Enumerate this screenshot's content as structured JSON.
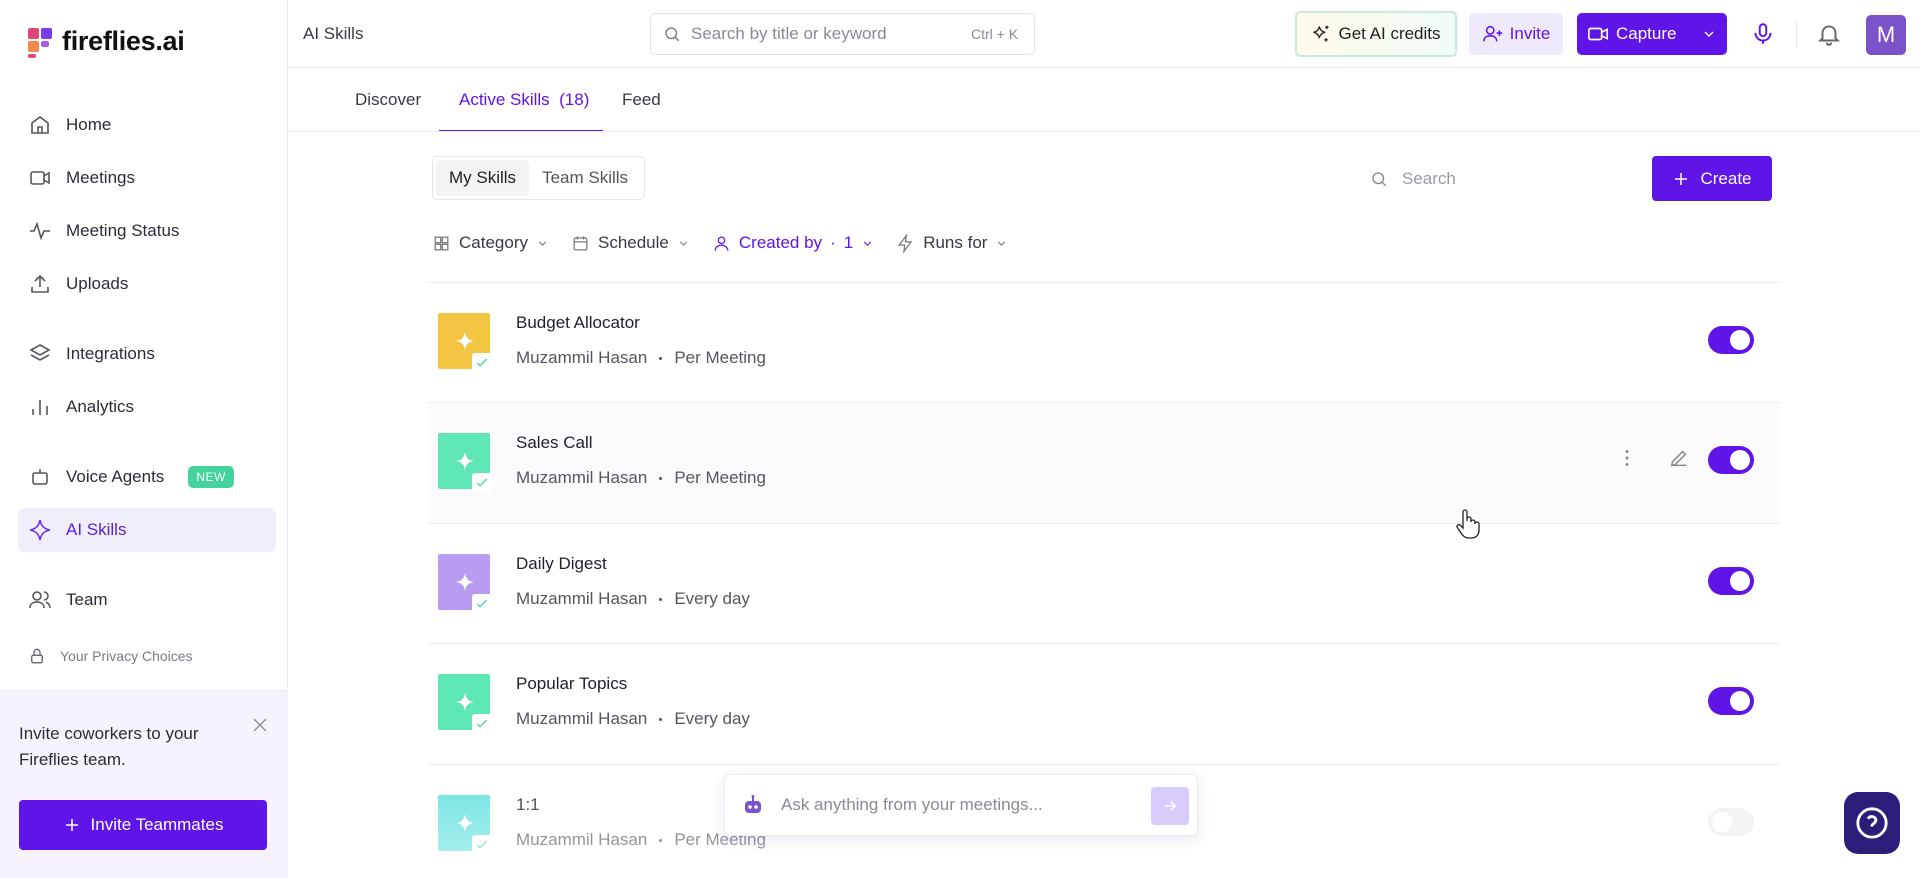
{
  "app": {
    "name": "fireflies.ai"
  },
  "header": {
    "breadcrumb": "AI Skills",
    "search_placeholder": "Search by title or keyword",
    "search_shortcut": "Ctrl + K",
    "credits_label": "Get AI credits",
    "invite_label": "Invite",
    "capture_label": "Capture",
    "avatar_initial": "M"
  },
  "sidebar": {
    "items": [
      {
        "label": "Home",
        "icon": "home-icon"
      },
      {
        "label": "Meetings",
        "icon": "video-icon"
      },
      {
        "label": "Meeting Status",
        "icon": "activity-icon"
      },
      {
        "label": "Uploads",
        "icon": "upload-icon"
      },
      {
        "label": "Integrations",
        "icon": "layers-icon"
      },
      {
        "label": "Analytics",
        "icon": "bar-chart-icon"
      },
      {
        "label": "Voice Agents",
        "icon": "robot-icon",
        "badge": "NEW"
      },
      {
        "label": "AI Skills",
        "icon": "sparkle-icon",
        "active": true
      },
      {
        "label": "Team",
        "icon": "users-icon"
      }
    ],
    "privacy_label": "Your Privacy Choices",
    "invite_card": {
      "text": "Invite coworkers to your Fireflies team.",
      "button_label": "Invite Teammates"
    }
  },
  "tabs": [
    {
      "label": "Discover"
    },
    {
      "label": "Active Skills",
      "count": "(18)",
      "active": true
    },
    {
      "label": "Feed"
    }
  ],
  "segments": [
    {
      "label": "My Skills",
      "active": true
    },
    {
      "label": "Team Skills"
    }
  ],
  "list_search_placeholder": "Search",
  "create_label": "Create",
  "filters": [
    {
      "label": "Category",
      "icon": "grid-icon"
    },
    {
      "label": "Schedule",
      "icon": "calendar-icon"
    },
    {
      "label": "Created by",
      "value": "1",
      "icon": "user-icon",
      "active": true
    },
    {
      "label": "Runs for",
      "icon": "bolt-icon"
    }
  ],
  "skills": [
    {
      "name": "Budget Allocator",
      "author": "Muzammil Hasan",
      "frequency": "Per Meeting",
      "color": "#f4c542",
      "enabled": true
    },
    {
      "name": "Sales Call",
      "author": "Muzammil Hasan",
      "frequency": "Per Meeting",
      "color": "#5ee6b5",
      "enabled": true,
      "hovered": true
    },
    {
      "name": "Daily Digest",
      "author": "Muzammil Hasan",
      "frequency": "Every day",
      "color": "#b79cf2",
      "enabled": true
    },
    {
      "name": "Popular Topics",
      "author": "Muzammil Hasan",
      "frequency": "Every day",
      "color": "#5ee6b5",
      "enabled": true
    },
    {
      "name": "1:1",
      "author": "Muzammil Hasan",
      "frequency": "Per Meeting",
      "color": "#63e2e0",
      "enabled": false
    }
  ],
  "ask_placeholder": "Ask anything from your meetings...",
  "colors": {
    "accent": "#5f14e8",
    "active_bg": "#f1eefc",
    "new_badge": "#43d39b"
  }
}
